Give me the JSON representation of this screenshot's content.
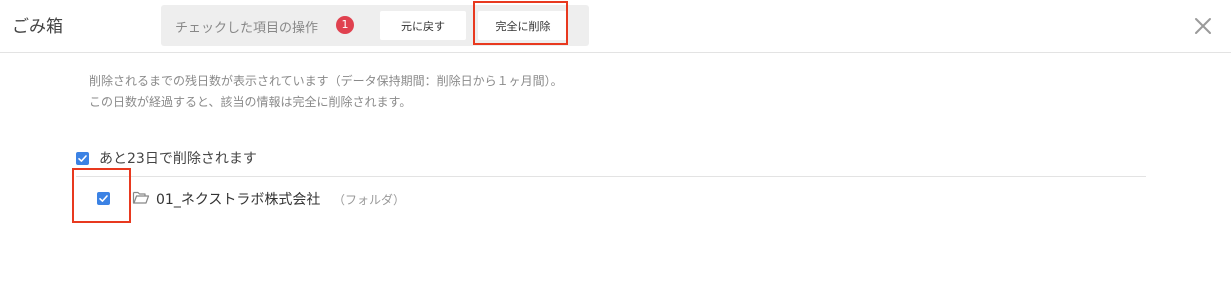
{
  "header": {
    "title": "ごみ箱",
    "close_icon": "close-icon"
  },
  "toolbar": {
    "label": "チェックした項目の操作",
    "selected_count": "1",
    "restore_label": "元に戻す",
    "delete_label": "完全に削除"
  },
  "notice": {
    "line1": "削除されるまでの残日数が表示されています（データ保持期間：削除日から１ヶ月間）。",
    "line2": "この日数が経過すると、該当の情報は完全に削除されます。"
  },
  "group": {
    "label": "あと23日で削除されます",
    "checked": true
  },
  "items": [
    {
      "name": "01_ネクストラボ株式会社",
      "type": "（フォルダ）",
      "icon": "folder-icon",
      "checked": true
    }
  ],
  "colors": {
    "accent": "#3b82e4",
    "badge": "#e0414f",
    "highlight": "#e8391f"
  }
}
